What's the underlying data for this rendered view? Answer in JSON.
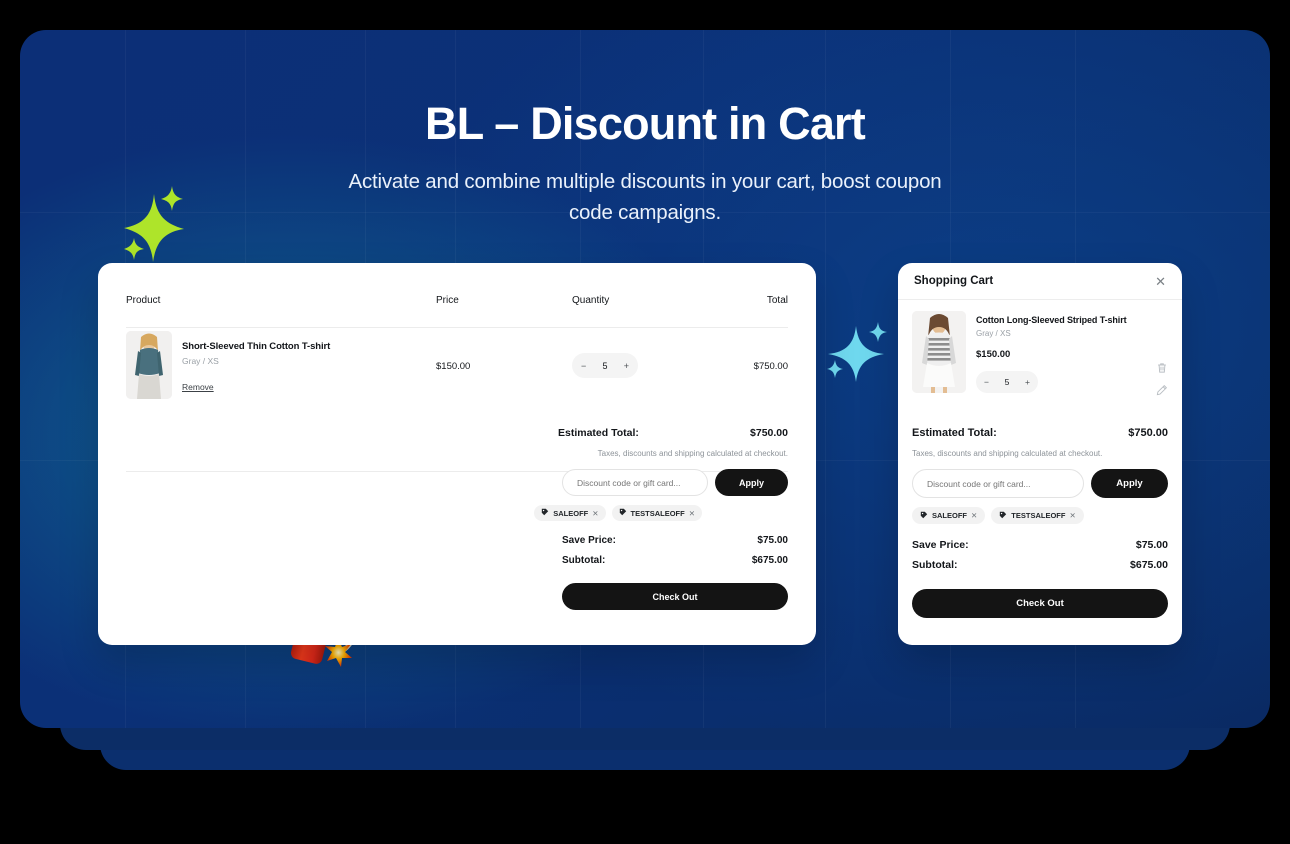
{
  "hero": {
    "title": "BL – Discount in Cart",
    "subtitle": "Activate and combine multiple discounts in your cart, boost coupon code campaigns.",
    "background_color": "#0b2f72",
    "accent_color": "#127ea0",
    "sparkle_green": "#aee42a",
    "sparkle_cyan": "#6fd8ee"
  },
  "decorations": {
    "green_sparkle": "sparkle-icon",
    "cyan_sparkle": "sparkle-icon",
    "dynamite": "dynamite-icon"
  },
  "cart_page": {
    "columns": {
      "product": "Product",
      "price": "Price",
      "quantity": "Quantity",
      "total": "Total"
    },
    "items": [
      {
        "title": "Short-Sleeved Thin Cotton T-shirt",
        "variant": "Gray / XS",
        "remove_label": "Remove",
        "price": "$150.00",
        "quantity": "5",
        "total": "$750.00",
        "minus": "−",
        "plus": "+"
      }
    ],
    "summary": {
      "estimated_total_label": "Estimated Total:",
      "estimated_total_value": "$750.00",
      "tax_note": "Taxes, discounts and shipping calculated at checkout.",
      "discount_placeholder": "Discount code or gift card...",
      "discount_value": "",
      "apply_label": "Apply",
      "chips": [
        {
          "label": "SALEOFF",
          "remove": "✕",
          "icon": "tag-icon"
        },
        {
          "label": "TESTSALEOFF",
          "remove": "✕",
          "icon": "tag-icon"
        }
      ],
      "save_price_label": "Save Price:",
      "save_price_value": "$75.00",
      "subtotal_label": "Subtotal:",
      "subtotal_value": "$675.00",
      "checkout_label": "Check Out"
    }
  },
  "cart_drawer": {
    "title": "Shopping Cart",
    "close_icon": "✕",
    "item": {
      "title": "Cotton Long-Sleeved Striped T-shirt",
      "variant": "Gray / XS",
      "price": "$150.00",
      "quantity": "5",
      "minus": "−",
      "plus": "+",
      "delete_icon": "trash-icon",
      "edit_icon": "pencil-icon"
    },
    "summary": {
      "estimated_total_label": "Estimated Total:",
      "estimated_total_value": "$750.00",
      "tax_note": "Taxes, discounts and shipping calculated at checkout.",
      "discount_placeholder": "Discount code or gift card...",
      "discount_value": "",
      "apply_label": "Apply",
      "chips": [
        {
          "label": "SALEOFF",
          "remove": "✕",
          "icon": "tag-icon"
        },
        {
          "label": "TESTSALEOFF",
          "remove": "✕",
          "icon": "tag-icon"
        }
      ],
      "save_price_label": "Save Price:",
      "save_price_value": "$75.00",
      "subtotal_label": "Subtotal:",
      "subtotal_value": "$675.00",
      "checkout_label": "Check Out"
    }
  }
}
